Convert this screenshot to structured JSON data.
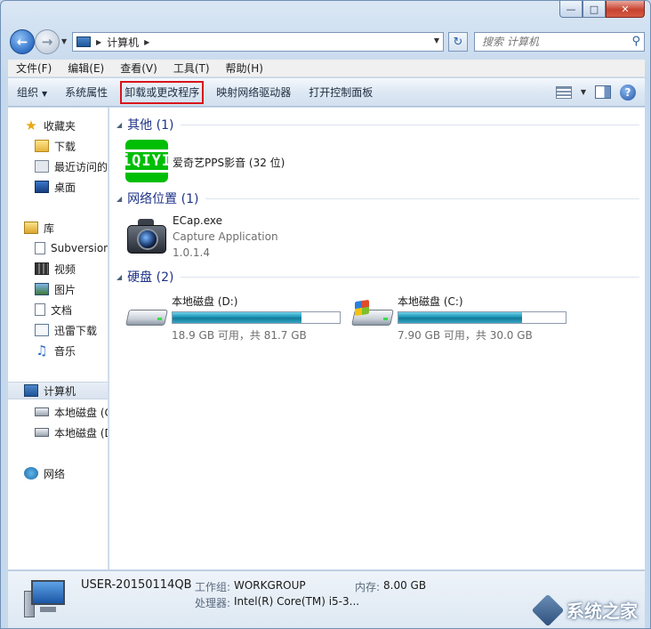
{
  "window": {
    "minimize": "—",
    "maximize": "□",
    "close": "✕"
  },
  "address": {
    "path": "计算机",
    "search_placeholder": "搜索 计算机"
  },
  "menu": [
    "文件(F)",
    "编辑(E)",
    "查看(V)",
    "工具(T)",
    "帮助(H)"
  ],
  "commands": {
    "organize": "组织",
    "system_properties": "系统属性",
    "uninstall": "卸载或更改程序",
    "map_drive": "映射网络驱动器",
    "control_panel": "打开控制面板"
  },
  "nav": {
    "favorites": "收藏夹",
    "downloads": "下载",
    "recent": "最近访问的",
    "desktop": "桌面",
    "libraries": "库",
    "subversion": "Subversion",
    "videos": "视频",
    "pictures": "图片",
    "documents": "文档",
    "xunlei": "迅雷下载",
    "music": "音乐",
    "computer": "计算机",
    "drive_c": "本地磁盘 (C",
    "drive_d": "本地磁盘 (D",
    "network": "网络"
  },
  "groups": {
    "other": "其他 (1)",
    "network_location": "网络位置 (1)",
    "hard_disk": "硬盘 (2)"
  },
  "items": {
    "iqiyi": {
      "logo": "iQIYI",
      "name": "爱奇艺PPS影音 (32 位)"
    },
    "ecap": {
      "name": "ECap.exe",
      "desc": "Capture Application",
      "version": "1.0.1.4"
    },
    "drive_d": {
      "name": "本地磁盘 (D:)",
      "free": "18.9 GB 可用，共 81.7 GB",
      "used_fraction": 0.77
    },
    "drive_c": {
      "name": "本地磁盘 (C:)",
      "free": "7.90 GB 可用，共 30.0 GB",
      "used_fraction": 0.74
    }
  },
  "details": {
    "pc_name": "USER-20150114QB",
    "workgroup_label": "工作组:",
    "workgroup": "WORKGROUP",
    "memory_label": "内存:",
    "memory": "8.00 GB",
    "cpu_label": "处理器:",
    "cpu": "Intel(R) Core(TM) i5-3..."
  },
  "watermark": "系统之家",
  "colors": {
    "highlight_box": "#d8141c",
    "group_title": "#1e3287",
    "bar_fill": "#1c93b5"
  }
}
